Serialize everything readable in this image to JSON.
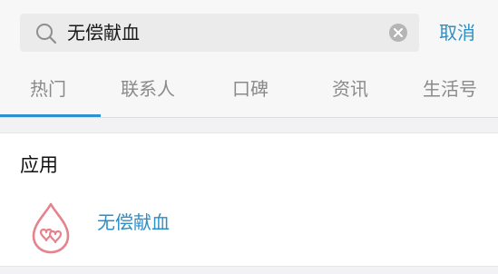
{
  "search": {
    "query": "无偿献血",
    "search_icon": "search-icon",
    "clear_icon": "clear-icon",
    "cancel_label": "取消"
  },
  "tabs": [
    {
      "label": "热门",
      "active": true
    },
    {
      "label": "联系人",
      "active": false
    },
    {
      "label": "口碑",
      "active": false
    },
    {
      "label": "资讯",
      "active": false
    },
    {
      "label": "生活号",
      "active": false
    }
  ],
  "results": {
    "section_title": "应用",
    "apps": [
      {
        "name": "无偿献血",
        "icon": "blood-drop-hearts-icon"
      }
    ]
  },
  "colors": {
    "accent": "#2d8fc6",
    "tab_indicator": "#2f8fd0",
    "icon_pink": "#e5828d",
    "background": "#f2f2f4"
  }
}
